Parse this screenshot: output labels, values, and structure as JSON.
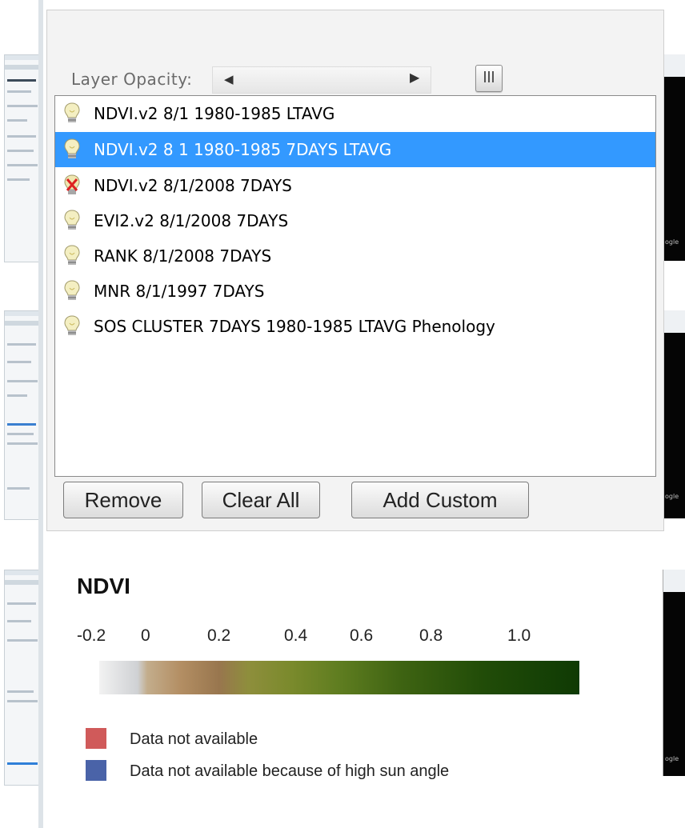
{
  "opacity": {
    "label": "Layer Opacity:",
    "thumb_glyph": "III"
  },
  "layers": [
    {
      "label": "NDVI.v2 8/1 1980-1985 LTAVG",
      "icon": "lightbulb-icon",
      "selected": false
    },
    {
      "label": "NDVI.v2 8 1 1980-1985 7DAYS LTAVG",
      "icon": "lightbulb-icon",
      "selected": true
    },
    {
      "label": "NDVI.v2 8/1/2008 7DAYS",
      "icon": "error-x-icon",
      "selected": false
    },
    {
      "label": "EVI2.v2 8/1/2008 7DAYS",
      "icon": "lightbulb-icon",
      "selected": false
    },
    {
      "label": "RANK 8/1/2008 7DAYS",
      "icon": "lightbulb-icon",
      "selected": false
    },
    {
      "label": "MNR 8/1/1997 7DAYS",
      "icon": "lightbulb-icon",
      "selected": false
    },
    {
      "label": "SOS CLUSTER 7DAYS 1980-1985 LTAVG Phenology",
      "icon": "lightbulb-icon",
      "selected": false
    }
  ],
  "buttons": {
    "remove": "Remove",
    "clear_all": "Clear All",
    "add_custom": "Add Custom"
  },
  "legend": {
    "title": "NDVI",
    "ticks": [
      "-0.2",
      "0",
      "0.2",
      "0.4",
      "0.6",
      "0.8",
      "1.0"
    ],
    "not_available": "Data not available",
    "not_available_color": "#d05a5a",
    "sun_angle": "Data not available because of high sun angle",
    "sun_angle_color": "#4a63a8"
  },
  "colors": {
    "selection": "#3399ff"
  }
}
